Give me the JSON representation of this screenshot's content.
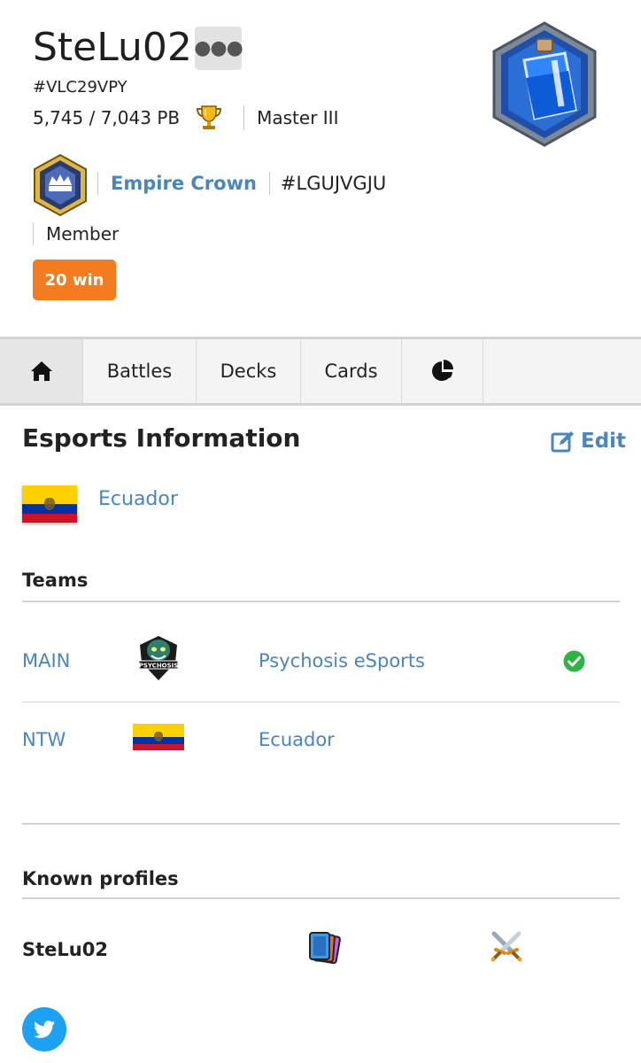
{
  "player": {
    "name": "SteLu02",
    "more_icon": "ellipsis-icon",
    "tag": "#VLC29VPY",
    "trophies": "5,745 / 7,043 PB",
    "trophy_icon": "trophy-icon",
    "league": "Master III",
    "arena_icon": "elixir-bottle-arena-badge"
  },
  "clan": {
    "badge_icon": "clan-crown-badge",
    "name": "Empire Crown",
    "tag": "#LGUJVGJU",
    "role": "Member"
  },
  "win_badge": "20 win",
  "tabs": [
    {
      "label": "",
      "icon": "home-icon",
      "active": true
    },
    {
      "label": "Battles"
    },
    {
      "label": "Decks"
    },
    {
      "label": "Cards"
    },
    {
      "label": "",
      "icon": "pie-chart-icon"
    }
  ],
  "esports": {
    "title": "Esports Information",
    "edit_label": "Edit",
    "country": "Ecuador",
    "teams_heading": "Teams",
    "teams": [
      {
        "type": "MAIN",
        "logo": "psychosis-logo",
        "name": "Psychosis eSports",
        "verified": true
      },
      {
        "type": "NTW",
        "logo": "ecuador-flag",
        "name": "Ecuador",
        "verified": false
      }
    ],
    "known_profiles_heading": "Known profiles",
    "profiles": [
      {
        "name": "SteLu02",
        "icons": [
          "cards-icon",
          "crossed-swords-icon"
        ]
      }
    ],
    "social_icon": "twitter-icon"
  },
  "colors": {
    "link": "#4a86b9",
    "win_badge": "#f47c20",
    "verified": "#2fb344",
    "twitter": "#1da1f2"
  }
}
